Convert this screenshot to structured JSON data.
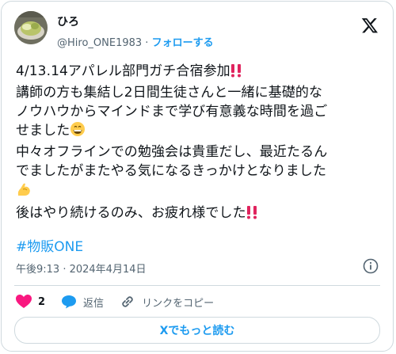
{
  "author": {
    "name": "ひろ",
    "handle": "@Hiro_ONE1983",
    "separator": " · ",
    "follow_label": "フォローする"
  },
  "tweet": {
    "line1": "4/13.14アパレル部門ガチ合宿参加",
    "line2": "講師の方も集結し2日間生徒さんと一緒に基礎的な\nノウハウからマインドまで学び有意義な時間を過ご\nせました",
    "line3": "中々オフラインでの勉強会は貴重だし、最近たるん\nでましたがまたやる気になるきっかけとなりました",
    "line4": "後はやり続けるのみ、お疲れ様でした",
    "hashtag": "#物販ONE"
  },
  "meta": {
    "time": "午後9:13 · 2024年4月14日"
  },
  "actions": {
    "like_count": "2",
    "reply_label": "返信",
    "copy_link_label": "リンクをコピー"
  },
  "read_more_label": "Xでもっと読む",
  "colors": {
    "accent": "#1d9bf0",
    "like": "#f91880",
    "text": "#0f1419",
    "secondary": "#536471",
    "border": "#cfd9de"
  }
}
